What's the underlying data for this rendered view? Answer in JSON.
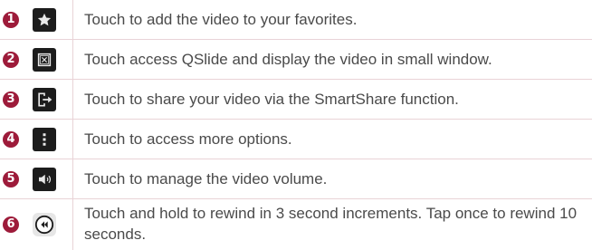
{
  "rows": [
    {
      "number": "1",
      "icon": "star-icon",
      "text": "Touch to add the video to your favorites."
    },
    {
      "number": "2",
      "icon": "qslide-icon",
      "text": "Touch access QSlide and display the video in small window."
    },
    {
      "number": "3",
      "icon": "share-icon",
      "text": "Touch to share your video via the SmartShare function."
    },
    {
      "number": "4",
      "icon": "more-options-icon",
      "text": "Touch to access more options."
    },
    {
      "number": "5",
      "icon": "volume-icon",
      "text": "Touch to manage the video volume."
    },
    {
      "number": "6",
      "icon": "rewind-icon",
      "text": "Touch and hold to rewind in 3 second increments. Tap once to rewind 10 seconds."
    }
  ],
  "colors": {
    "badge": "#9d1b3a",
    "divider": "#e9d3d7",
    "icon_dark": "#1c1c1c"
  }
}
